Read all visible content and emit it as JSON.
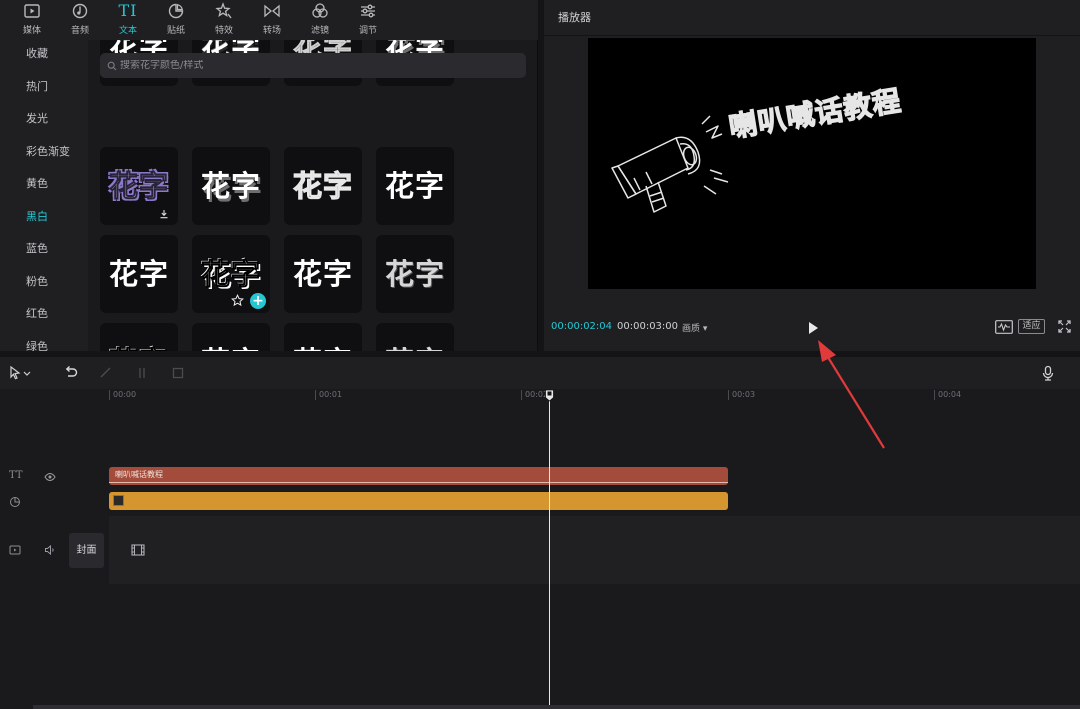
{
  "toolbar": {
    "tabs": [
      {
        "label": "媒体",
        "icon": "media-icon"
      },
      {
        "label": "音频",
        "icon": "audio-icon"
      },
      {
        "label": "文本",
        "icon": "text-icon",
        "glyph": "TI"
      },
      {
        "label": "贴纸",
        "icon": "sticker-icon"
      },
      {
        "label": "特效",
        "icon": "effects-icon"
      },
      {
        "label": "转场",
        "icon": "transition-icon"
      },
      {
        "label": "滤镜",
        "icon": "filter-icon"
      },
      {
        "label": "调节",
        "icon": "adjust-icon"
      }
    ],
    "active_tab": "文本"
  },
  "sidebar": {
    "items": [
      {
        "label": "收藏"
      },
      {
        "label": "热门"
      },
      {
        "label": "发光"
      },
      {
        "label": "彩色渐变"
      },
      {
        "label": "黄色"
      },
      {
        "label": "黑白"
      },
      {
        "label": "蓝色"
      },
      {
        "label": "粉色"
      },
      {
        "label": "红色"
      },
      {
        "label": "绿色"
      }
    ],
    "active_item": "黑白"
  },
  "search": {
    "placeholder": "搜索花字颜色/样式"
  },
  "styles": {
    "tile_text": "花字",
    "rows": [
      [
        "s-white",
        "s-dark-stroke",
        "s-thin-outline",
        "s-bevel"
      ],
      [
        "s-purple",
        "s-bevel",
        "s-hollow",
        "s-white"
      ],
      [
        "s-white",
        "s-outline-white",
        "s-white",
        "s-grey"
      ],
      [
        "s-outline-white",
        "s-white",
        "s-white",
        "s-grey"
      ]
    ]
  },
  "player": {
    "title": "播放器",
    "preview_text": "喇叭喊话教程",
    "time_current": "00:00:02:04",
    "time_total": "00:00:03:00",
    "quality": "画质",
    "fit_label": "适应"
  },
  "timeline": {
    "ruler": [
      "00:00",
      "00:01",
      "00:02",
      "00:03",
      "00:04"
    ],
    "text_clip_label": "喇叭喊话教程",
    "cover_label": "封面"
  },
  "colors": {
    "accent": "#25c7d3",
    "text_clip": "#a34c3b",
    "sticker_clip": "#d6962f",
    "arrow": "#e03a3a"
  }
}
